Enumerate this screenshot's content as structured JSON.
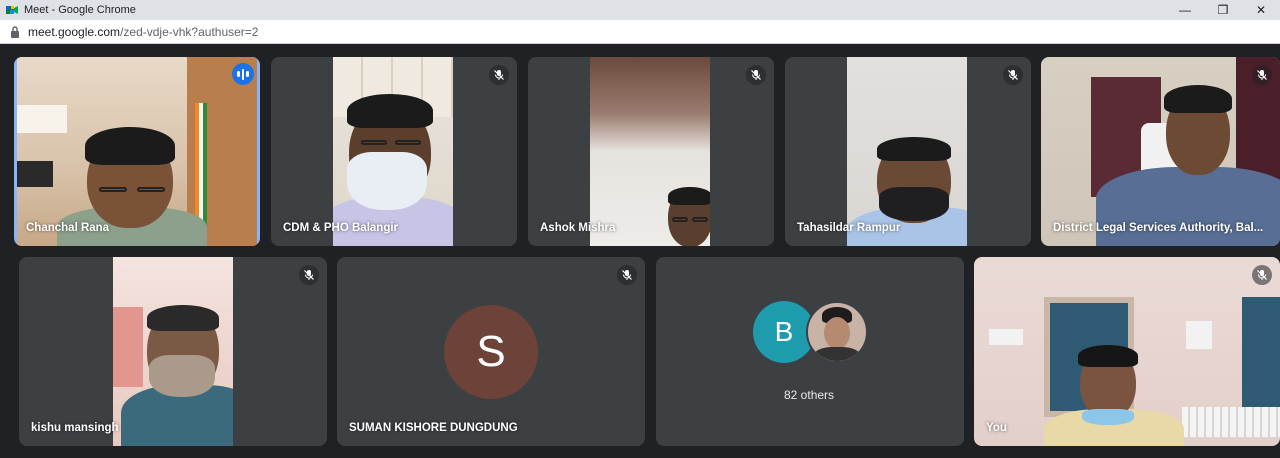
{
  "window": {
    "title": "Meet - Google Chrome",
    "url_host": "meet.google.com",
    "url_path": "/zed-vdje-vhk?authuser=2"
  },
  "window_controls": {
    "minimize": "—",
    "maximize": "❒",
    "close": "✕"
  },
  "participants": {
    "p1": {
      "name": "Chanchal Rana",
      "status": "speaking"
    },
    "p2": {
      "name": "CDM & PHO Balangir",
      "status": "muted"
    },
    "p3": {
      "name": "Ashok Mishra",
      "status": "muted"
    },
    "p4": {
      "name": "Tahasildar Rampur",
      "status": "muted"
    },
    "p5": {
      "name": "District Legal Services Authority, Bal...",
      "status": "muted"
    },
    "p6": {
      "name": "kishu mansingh",
      "status": "muted"
    },
    "p7": {
      "name": "SUMAN KISHORE DUNGDUNG",
      "status": "muted",
      "avatar_letter": "S"
    },
    "p8": {
      "others_label": "82 others",
      "avatar_letter": "B"
    },
    "p9": {
      "name": "You",
      "status": "muted"
    }
  },
  "colors": {
    "background": "#202124",
    "tile": "#3c4043",
    "active_border": "#8ab4f8",
    "speaking_badge": "#1a73e8",
    "avatar_s": "#6d4238",
    "avatar_b": "#1e9bad"
  },
  "icons": {
    "mic_off": "mic-off-icon",
    "speaking": "audio-level-icon",
    "lock": "lock-icon",
    "app": "meet-logo-icon"
  }
}
